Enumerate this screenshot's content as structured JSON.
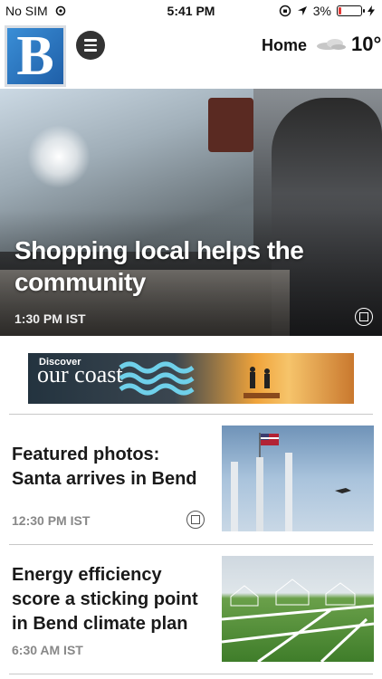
{
  "status_bar": {
    "carrier": "No SIM",
    "time": "5:41 PM",
    "battery": "3%",
    "battery_level": 0.03
  },
  "header": {
    "logo_letter": "B",
    "nav_label": "Home",
    "temperature": "10°",
    "weather_icon": "cloud-icon"
  },
  "hero": {
    "title": "Shopping local helps the community",
    "time": "1:30 PM IST"
  },
  "ad": {
    "tagline": "Discover",
    "brand": "our coast"
  },
  "stories": [
    {
      "title": "Featured photos: Santa arrives in Bend",
      "time": "12:30 PM IST"
    },
    {
      "title": "Energy efficiency score a sticking point in Bend climate plan",
      "time": "6:30 AM IST"
    }
  ],
  "colors": {
    "accent": "#1f5fa8",
    "battery_low": "#e53935"
  }
}
